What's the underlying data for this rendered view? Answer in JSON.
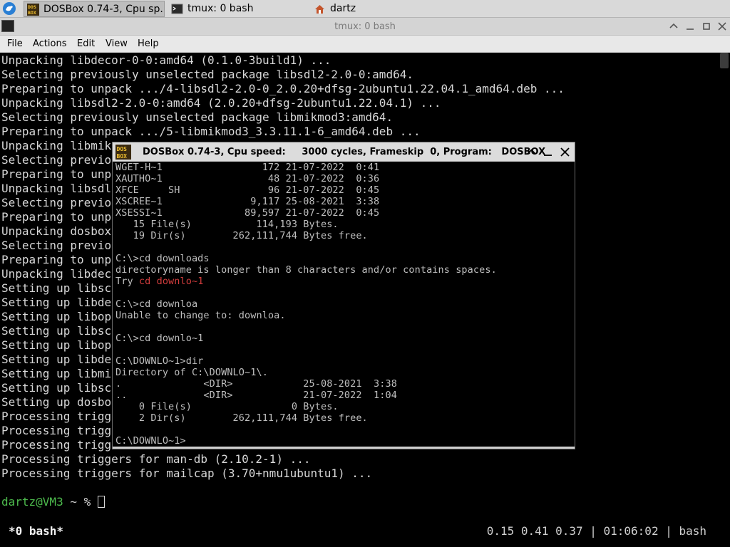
{
  "taskbar": {
    "tasks": [
      {
        "label": "DOSBox 0.74-3, Cpu sp...",
        "icon": "dosbox-icon"
      },
      {
        "label": "tmux: 0 bash",
        "icon": "terminal-icon"
      },
      {
        "label": "dartz",
        "icon": "home-folder-icon"
      }
    ]
  },
  "window": {
    "title": "tmux: 0 bash",
    "menu": [
      "File",
      "Actions",
      "Edit",
      "View",
      "Help"
    ]
  },
  "terminal": {
    "lines": [
      "Unpacking libdecor-0-0:amd64 (0.1.0-3build1) ...",
      "Selecting previously unselected package libsdl2-2.0-0:amd64.",
      "Preparing to unpack .../4-libsdl2-2.0-0_2.0.20+dfsg-2ubuntu1.22.04.1_amd64.deb ...",
      "Unpacking libsdl2-2.0-0:amd64 (2.0.20+dfsg-2ubuntu1.22.04.1) ...",
      "Selecting previously unselected package libmikmod3:amd64.",
      "Preparing to unpack .../5-libmikmod3_3.3.11.1-6_amd64.deb ...",
      "Unpacking libmik",
      "Selecting previo",
      "Preparing to unp",
      "Unpacking libsdl",
      "Selecting previo",
      "Preparing to unp",
      "Unpacking dosbox",
      "Selecting previo",
      "Preparing to unp",
      "Unpacking libdec",
      "Setting up libsc",
      "Setting up libde",
      "Setting up libop",
      "Setting up libsc",
      "Setting up libop",
      "Setting up libde",
      "Setting up libmi",
      "Setting up libsc",
      "Setting up dosbo",
      "Processing trigg",
      "Processing trigg",
      "Processing trigg",
      "Processing triggers for man-db (2.10.2-1) ...",
      "Processing triggers for mailcap (3.70+nmu1ubuntu1) ..."
    ],
    "prompt_user": "dartz@VM3",
    "prompt_rest": " ~ % "
  },
  "status": {
    "left": "*0 bash*",
    "right": "0.15 0.41 0.37 | 01:06:02 | bash"
  },
  "dosbox": {
    "title": "DOSBox 0.74-3, Cpu speed:     3000 cycles, Frameskip  0, Program:   DOSBOX",
    "lines": [
      {
        "text": "WGET-H~1                 172 21-07-2022  0:41"
      },
      {
        "text": "XAUTHO~1                  48 21-07-2022  0:36"
      },
      {
        "text": "XFCE     SH               96 21-07-2022  0:45"
      },
      {
        "text": "XSCREE~1               9,117 25-08-2021  3:38"
      },
      {
        "text": "XSESSI~1              89,597 21-07-2022  0:45"
      },
      {
        "text": "   15 File(s)           114,193 Bytes."
      },
      {
        "text": "   19 Dir(s)        262,111,744 Bytes free."
      },
      {
        "text": ""
      },
      {
        "text": "C:\\>cd downloads"
      },
      {
        "text": "directoryname is longer than 8 characters and/or contains spaces."
      },
      {
        "text": "Try ",
        "red": "cd downlo~1"
      },
      {
        "text": ""
      },
      {
        "text": "C:\\>cd downloa"
      },
      {
        "text": "Unable to change to: downloa."
      },
      {
        "text": ""
      },
      {
        "text": "C:\\>cd downlo~1"
      },
      {
        "text": ""
      },
      {
        "text": "C:\\DOWNLO~1>dir"
      },
      {
        "text": "Directory of C:\\DOWNLO~1\\."
      },
      {
        "text": ".              <DIR>            25-08-2021  3:38"
      },
      {
        "text": "..             <DIR>            21-07-2022  1:04"
      },
      {
        "text": "    0 File(s)                 0 Bytes."
      },
      {
        "text": "    2 Dir(s)        262,111,744 Bytes free."
      },
      {
        "text": ""
      },
      {
        "text": "C:\\DOWNLO~1>"
      }
    ]
  },
  "colors": {
    "terminal_bg": "#000000",
    "terminal_fg": "#d7d7d7",
    "prompt_green": "#4dbb4d",
    "dos_red": "#d23c3c"
  }
}
